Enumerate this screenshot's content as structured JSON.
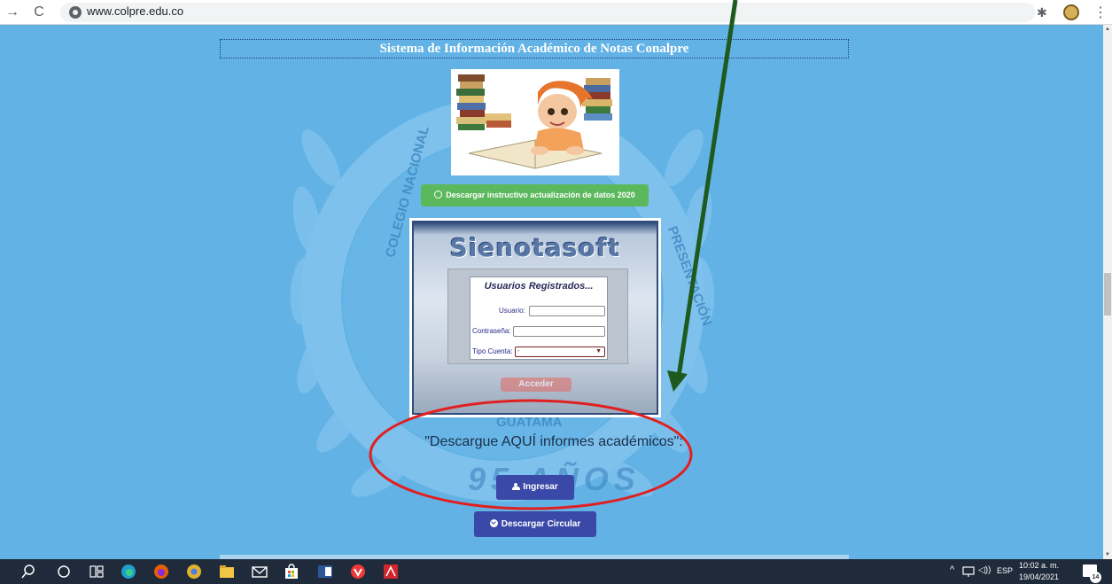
{
  "browser": {
    "url": "www.colpre.edu.co"
  },
  "page": {
    "title": "Sistema de Información Académico de Notas Conalpre",
    "instructivo_button": "Descargar instructivo actualización de datos 2020",
    "login": {
      "brand": "Sienotasoft",
      "panel_title": "Usuarios Registrados...",
      "usuario_label": "Usuario:",
      "password_label": "Contraseña:",
      "tipo_cuenta_label": "Tipo Cuenta:",
      "tipo_cuenta_value": "-",
      "acceder_label": "Acceder"
    },
    "download_text": "\"Descargue AQUÍ informes académicos\":",
    "ingresar_button": "Ingresar",
    "circular_button": "Descargar Circular",
    "watermark": {
      "ring_left": "COLEGIO NACIONAL",
      "ring_right": "PRESENTACIÓN",
      "ring_bottom": "GUATAMA",
      "anniversary": "95 AÑOS"
    }
  },
  "taskbar": {
    "language": "ESP",
    "time": "10:02 a. m.",
    "date": "19/04/2021",
    "notification_count": "14"
  },
  "colors": {
    "page_background": "#62b2e5",
    "instructivo_green": "#5cb85c",
    "button_blue": "#3a49a7",
    "annotation_arrow": "#1e5a1e",
    "annotation_ellipse": "#e02020",
    "taskbar": "#1f2a3a"
  }
}
